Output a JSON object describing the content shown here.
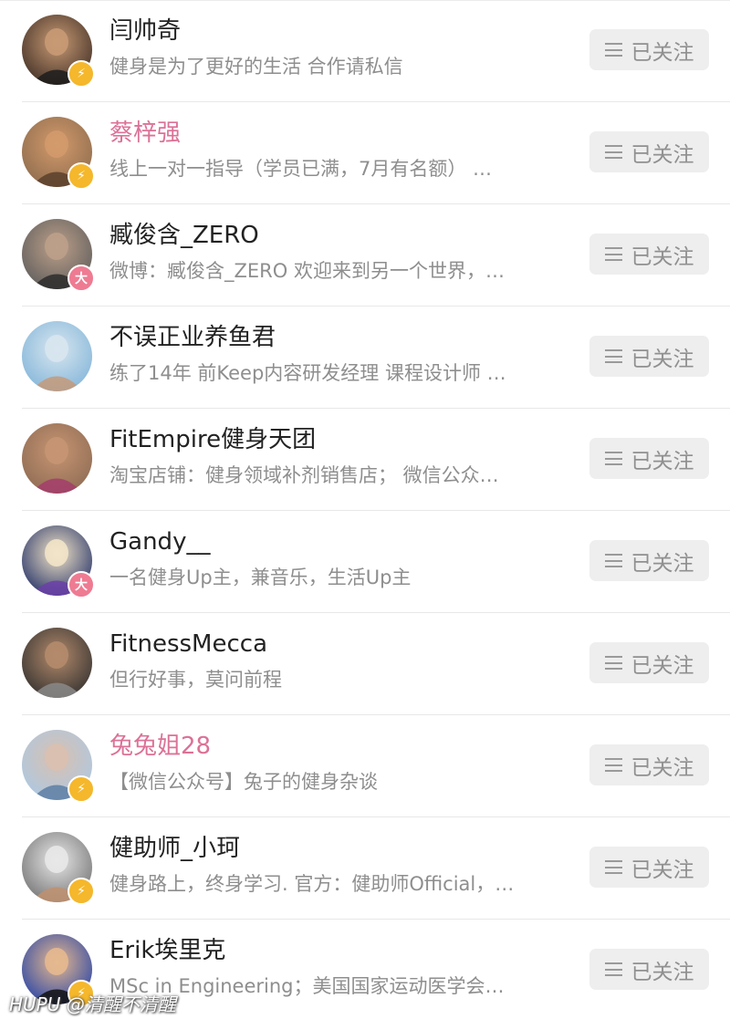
{
  "follow_list": [
    {
      "name": "闫帅奇",
      "name_color": "#222222",
      "description": "健身是为了更好的生活 合作请私信",
      "badge": "lightning",
      "badge_text": "⚡",
      "follow_label": "已关注",
      "avatar_palette": [
        "#3a2a22",
        "#c89a74",
        "#1c1c1c"
      ]
    },
    {
      "name": "蔡梓强",
      "name_color": "#dc7197",
      "description": "线上一对一指导（学员已满，7月有名额） …",
      "badge": "lightning",
      "badge_text": "⚡",
      "follow_label": "已关注",
      "avatar_palette": [
        "#8a6a4c",
        "#d39a6c",
        "#5b3f2b"
      ]
    },
    {
      "name": "臧俊含_ZERO",
      "name_color": "#222222",
      "description": "微博：臧俊含_ZERO 欢迎来到另一个世界，…",
      "badge": "da",
      "badge_text": "大",
      "follow_label": "已关注",
      "avatar_palette": [
        "#5a5a5a",
        "#bda08a",
        "#2d2d2d"
      ]
    },
    {
      "name": "不误正业养鱼君",
      "name_color": "#222222",
      "description": "练了14年 前Keep内容研发经理 课程设计师 …",
      "badge": "",
      "badge_text": "",
      "follow_label": "已关注",
      "avatar_palette": [
        "#7fb3d8",
        "#d8e6ef",
        "#c49a7a"
      ]
    },
    {
      "name": "FitEmpire健身天团",
      "name_color": "#222222",
      "description": "淘宝店铺：健身领域补剂销售店； 微信公众…",
      "badge": "",
      "badge_text": "",
      "follow_label": "已关注",
      "avatar_palette": [
        "#8c6a52",
        "#c79573",
        "#a33d6b"
      ]
    },
    {
      "name": "Gandy__",
      "name_color": "#222222",
      "description": "一名健身Up主，兼音乐，生活Up主",
      "badge": "da",
      "badge_text": "大",
      "follow_label": "已关注",
      "avatar_palette": [
        "#1b2a63",
        "#f2e4c8",
        "#6b3fa8"
      ]
    },
    {
      "name": "FitnessMecca",
      "name_color": "#222222",
      "description": "但行好事，莫问前程",
      "badge": "",
      "badge_text": "",
      "follow_label": "已关注",
      "avatar_palette": [
        "#2d2d2d",
        "#b48b6c",
        "#8a8a8a"
      ]
    },
    {
      "name": "兔兔姐28",
      "name_color": "#dc7197",
      "description": "【微信公众号】兔子的健身杂谈",
      "badge": "lightning",
      "badge_text": "⚡",
      "follow_label": "已关注",
      "avatar_palette": [
        "#a9c9e6",
        "#d9c0b0",
        "#5d7ea3"
      ]
    },
    {
      "name": "健助师_小珂",
      "name_color": "#222222",
      "description": "健身路上，终身学习. 官方：健助师Official，…",
      "badge": "lightning",
      "badge_text": "⚡",
      "follow_label": "已关注",
      "avatar_palette": [
        "#6e6e6e",
        "#e8e8e8",
        "#c09070"
      ]
    },
    {
      "name": "Erik埃里克",
      "name_color": "#222222",
      "description": "MSc in Engineering；美国国家运动医学会…",
      "badge": "lightning",
      "badge_text": "⚡",
      "follow_label": "已关注",
      "avatar_palette": [
        "#1f3fa8",
        "#e6b98f",
        "#111111"
      ]
    }
  ],
  "watermark": "HUPU @清醒不清醒"
}
